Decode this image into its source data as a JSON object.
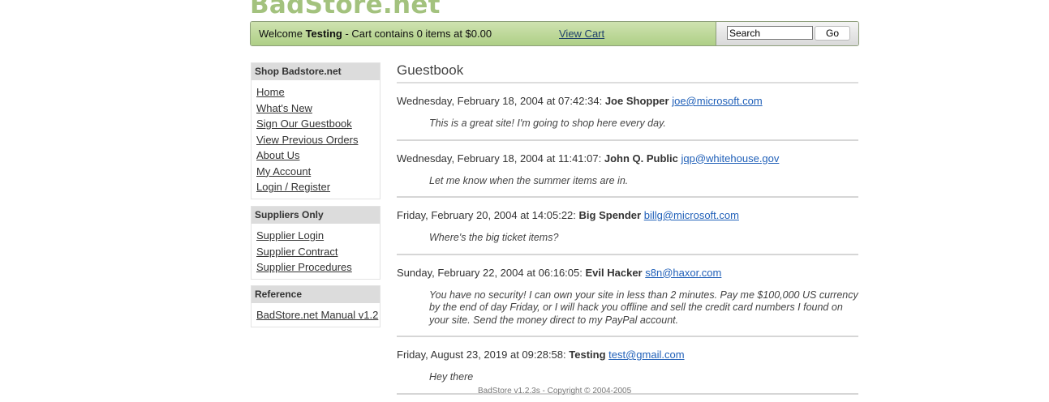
{
  "site": {
    "logo": "BadStore.net"
  },
  "topbar": {
    "welcome_prefix": "Welcome ",
    "user": "Testing",
    "cart_text": " - Cart contains 0 items at $0.00",
    "view_cart": "View Cart",
    "search_value": "Search",
    "go_label": "Go"
  },
  "sidebar": {
    "shop": {
      "title": "Shop Badstore.net",
      "items": [
        "Home",
        "What's New",
        "Sign Our Guestbook",
        "View Previous Orders",
        "About Us",
        "My Account",
        "Login / Register"
      ]
    },
    "suppliers": {
      "title": "Suppliers Only",
      "items": [
        "Supplier Login",
        "Supplier Contract",
        "Supplier Procedures"
      ]
    },
    "reference": {
      "title": "Reference",
      "items": [
        "BadStore.net Manual v1.2"
      ]
    }
  },
  "main": {
    "title": "Guestbook",
    "entries": [
      {
        "date": "Wednesday, February 18, 2004 at 07:42:34:",
        "name": "Joe Shopper",
        "email": "joe@microsoft.com",
        "message": "This is a great site! I'm going to shop here every day."
      },
      {
        "date": "Wednesday, February 18, 2004 at 11:41:07:",
        "name": "John Q. Public",
        "email": "jqp@whitehouse.gov",
        "message": "Let me know when the summer items are in."
      },
      {
        "date": "Friday, February 20, 2004 at 14:05:22:",
        "name": "Big Spender",
        "email": "billg@microsoft.com",
        "message": "Where's the big ticket items?"
      },
      {
        "date": "Sunday, February 22, 2004 at 06:16:05:",
        "name": "Evil Hacker",
        "email": "s8n@haxor.com",
        "message": "You have no security! I can own your site in less than 2 minutes. Pay me $100,000 US currency by the end of day Friday, or I will hack you offline and sell the credit card numbers I found on your site. Send the money direct to my PayPal account."
      },
      {
        "date": "Friday, August 23, 2019 at 09:28:58:",
        "name": "Testing",
        "email": "test@gmail.com",
        "message": "Hey there"
      }
    ]
  },
  "footer": {
    "text": "BadStore v1.2.3s - Copyright © 2004-2005"
  },
  "colors": {
    "logo": "#a3c27e",
    "bar_green": "#aecf86",
    "link": "#1f5fb8"
  }
}
